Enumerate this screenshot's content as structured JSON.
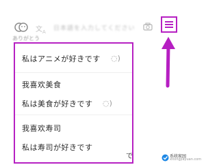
{
  "topbar": {
    "lang_icon": "translate-icon",
    "search_placeholder": "日本語を入力してください"
  },
  "list": {
    "faded_top": "ありがとう",
    "items": [
      {
        "text": "私はアニメが好きです",
        "has_audio": true
      },
      {
        "text": "我喜欢美食"
      },
      {
        "text": "私は美食が好きです",
        "has_audio": true
      },
      {
        "text": "我喜欢寿司"
      },
      {
        "text": "私は寿司が好きです"
      }
    ]
  },
  "peek_text": "で",
  "colors": {
    "highlight": "#b61fc2"
  },
  "watermark": {
    "name": "系统家园",
    "sub": "xitongjiayuan.com"
  }
}
